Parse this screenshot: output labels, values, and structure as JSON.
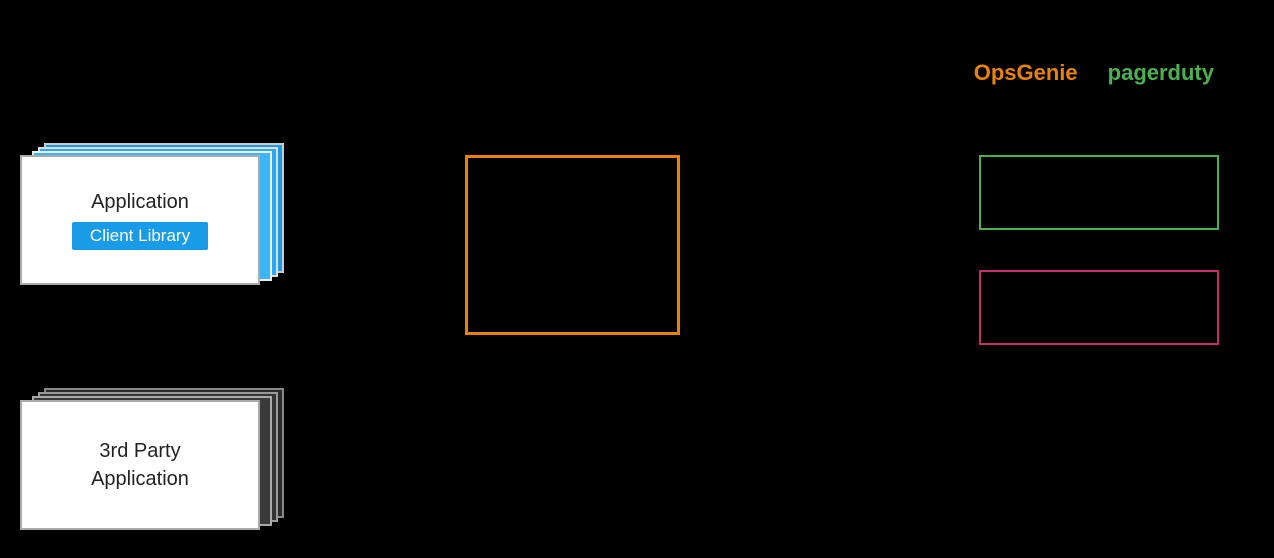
{
  "labels": {
    "opsgenie": "OpsGenie",
    "pagerduty": "pagerduty"
  },
  "application_stack": {
    "app_label": "Application",
    "client_library_label": "Client Library"
  },
  "third_party_stack": {
    "label_line1": "3rd Party",
    "label_line2": "Application"
  }
}
